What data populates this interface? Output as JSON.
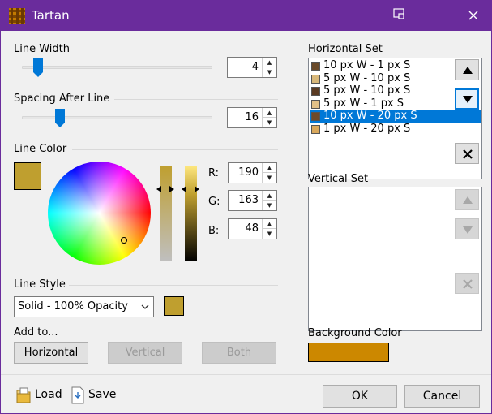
{
  "window": {
    "title": "Tartan"
  },
  "line_width": {
    "label": "Line Width",
    "value": "4",
    "slider_fraction": 0.06
  },
  "spacing": {
    "label": "Spacing After Line",
    "value": "16",
    "slider_fraction": 0.18
  },
  "line_color": {
    "label": "Line Color",
    "color": "#bf9f2f",
    "r_label": "R:",
    "g_label": "G:",
    "b_label": "B:",
    "r": "190",
    "g": "163",
    "b": "48"
  },
  "line_style": {
    "label": "Line Style",
    "selected": "Solid - 100% Opacity",
    "color": "#bf9f2f"
  },
  "add_to": {
    "label": "Add to...",
    "horizontal": "Horizontal",
    "vertical": "Vertical",
    "both": "Both"
  },
  "horizontal_set": {
    "label": "Horizontal Set",
    "items": [
      {
        "text": "10 px W - 1 px S",
        "color": "#6b4b2a"
      },
      {
        "text": "5 px W - 10 px S",
        "color": "#d8b87a"
      },
      {
        "text": "5 px W - 10 px S",
        "color": "#5a3a22"
      },
      {
        "text": "5 px W - 1 px S",
        "color": "#e2c188"
      },
      {
        "text": "10 px W - 20 px S",
        "color": "#6e4a2a"
      },
      {
        "text": "1 px W - 20 px S",
        "color": "#d9a85c"
      }
    ],
    "selected_index": 4
  },
  "vertical_set": {
    "label": "Vertical Set"
  },
  "background_color": {
    "label": "Background Color",
    "color": "#cc8800"
  },
  "footer": {
    "load": "Load",
    "save": "Save",
    "ok": "OK",
    "cancel": "Cancel"
  },
  "icons": {
    "app": "tartan-grid-icon",
    "pin": "pin-window-icon",
    "close": "close-icon",
    "move_up": "triangle-up-icon",
    "move_down": "triangle-down-icon",
    "delete": "x-icon",
    "load": "folder-load-icon",
    "save": "save-file-icon"
  }
}
